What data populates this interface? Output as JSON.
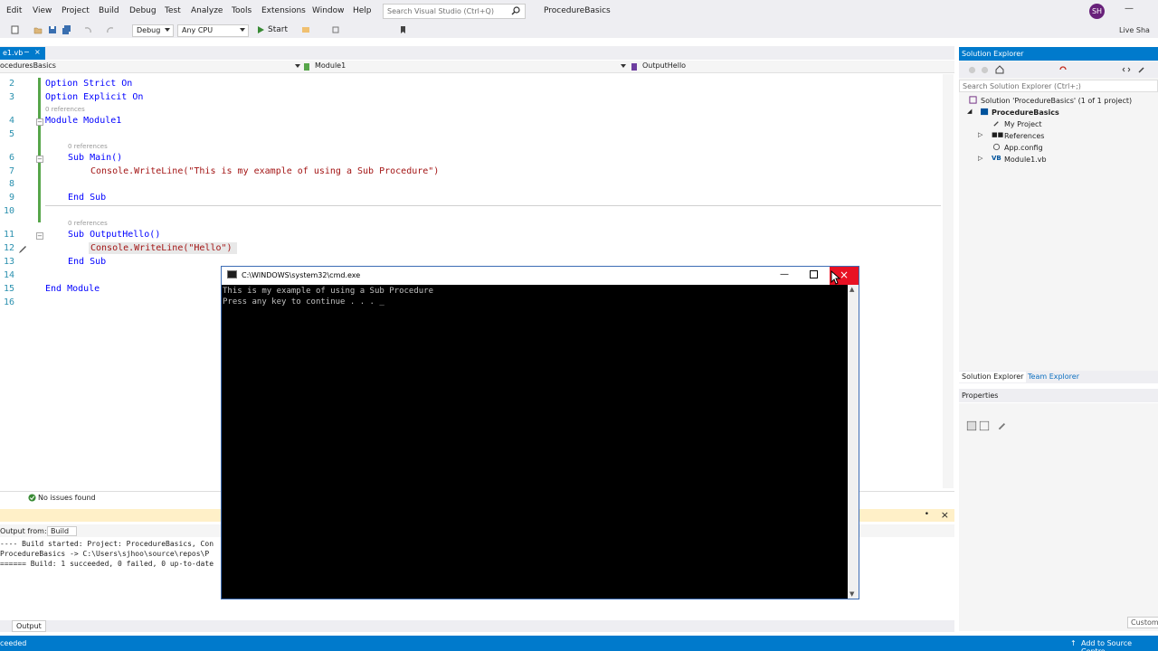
{
  "menu": {
    "items": [
      "Edit",
      "View",
      "Project",
      "Build",
      "Debug",
      "Test",
      "Analyze",
      "Tools",
      "Extensions",
      "Window",
      "Help"
    ],
    "search_placeholder": "Search Visual Studio (Ctrl+Q)",
    "solution_name": "ProcedureBasics",
    "avatar_initials": "SH"
  },
  "toolbar": {
    "config": "Debug",
    "platform": "Any CPU",
    "start_label": "Start",
    "live_share": "Live Sha"
  },
  "doc_tab": {
    "label": "e1.vb"
  },
  "navbar": {
    "project": "oceduresBasics",
    "module": "Module1",
    "member": "OutputHello"
  },
  "code": {
    "lines": [
      {
        "num": "2",
        "text": "Option Strict On"
      },
      {
        "num": "3",
        "text": "Option Explicit On"
      },
      {
        "num": "4",
        "text": "Module Module1"
      },
      {
        "num": "5",
        "text": ""
      },
      {
        "num": "6",
        "text": "Sub Main()"
      },
      {
        "num": "7",
        "text": "Console.WriteLine(\"This is my example of using a Sub Procedure\")"
      },
      {
        "num": "8",
        "text": ""
      },
      {
        "num": "9",
        "text": "End Sub"
      },
      {
        "num": "10",
        "text": ""
      },
      {
        "num": "11",
        "text": "Sub OutputHello()"
      },
      {
        "num": "12",
        "text": "Console.WriteLine(\"Hello\")"
      },
      {
        "num": "13",
        "text": "End Sub"
      },
      {
        "num": "14",
        "text": ""
      },
      {
        "num": "15",
        "text": "End Module"
      },
      {
        "num": "16",
        "text": ""
      }
    ],
    "references_label": "0 references"
  },
  "editor_status": {
    "issues": "No issues found"
  },
  "output": {
    "show_from_label": "Output from:",
    "show_from_value": "Build",
    "lines": [
      "---- Build started: Project: ProcedureBasics, Con",
      "ProcedureBasics -> C:\\Users\\sjhoo\\source\\repos\\P",
      "====== Build: 1 succeeded, 0 failed, 0 up-to-date"
    ],
    "tab_label": "Output"
  },
  "statusbar": {
    "left": "ceeded",
    "right": "Add to Source Contro"
  },
  "solution_explorer": {
    "title": "Solution Explorer",
    "search_placeholder": "Search Solution Explorer (Ctrl+;)",
    "items": [
      {
        "label": "Solution 'ProcedureBasics' (1 of 1 project)"
      },
      {
        "label": "ProcedureBasics"
      },
      {
        "label": "My Project"
      },
      {
        "label": "References"
      },
      {
        "label": "App.config"
      },
      {
        "label": "Module1.vb"
      }
    ],
    "tabs": [
      "Solution Explorer",
      "Team Explorer"
    ]
  },
  "properties": {
    "title": "Properties",
    "custom_label": "Custom"
  },
  "console": {
    "title": "C:\\WINDOWS\\system32\\cmd.exe",
    "lines": [
      "This is my example of using a Sub Procedure",
      "Press any key to continue . . . _"
    ]
  },
  "colors": {
    "accent": "#007acc",
    "close_red": "#e81123",
    "keyword": "#0000ff",
    "type": "#2b91af",
    "string": "#a31515"
  }
}
